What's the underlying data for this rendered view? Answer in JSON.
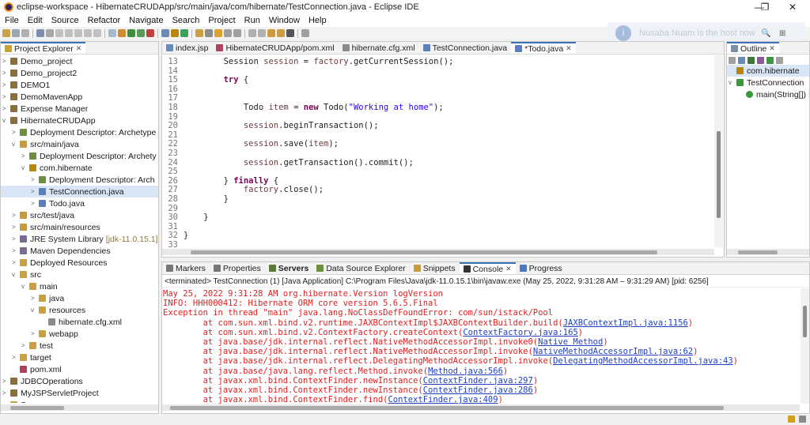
{
  "window": {
    "title": "eclipse-workspace - HibernateCRUDApp/src/main/java/com/hibernate/TestConnection.java - Eclipse IDE",
    "minimize": "—",
    "maximize": "❐",
    "close": "✕"
  },
  "menu": [
    "File",
    "Edit",
    "Source",
    "Refactor",
    "Navigate",
    "Search",
    "Project",
    "Run",
    "Window",
    "Help"
  ],
  "notification": {
    "avatar": "i",
    "text": "Nusaba Nuam is the host now"
  },
  "toolbar_right": {
    "search": "🔍",
    "perspective": "⊞"
  },
  "project_explorer": {
    "tab": "Project Explorer",
    "close": "✕",
    "items": [
      {
        "label": "Demo_project",
        "extra": "",
        "twisty": ">",
        "icon": "project",
        "color": "#8a6e3b",
        "depth": 0
      },
      {
        "label": "Demo_project2",
        "extra": "",
        "twisty": ">",
        "icon": "project",
        "color": "#8a6e3b",
        "depth": 0
      },
      {
        "label": "DEMO1",
        "extra": "",
        "twisty": ">",
        "icon": "project",
        "color": "#8a6e3b",
        "depth": 0
      },
      {
        "label": "DemoMavenApp",
        "extra": "",
        "twisty": ">",
        "icon": "project",
        "color": "#8a6e3b",
        "depth": 0
      },
      {
        "label": "Expense Manager",
        "extra": "",
        "twisty": ">",
        "icon": "project",
        "color": "#8a6e3b",
        "depth": 0
      },
      {
        "label": "HibernateCRUDApp",
        "extra": "",
        "twisty": "v",
        "icon": "project",
        "color": "#8a6e3b",
        "depth": 0
      },
      {
        "label": "Deployment Descriptor: Archetype",
        "extra": "",
        "twisty": ">",
        "icon": "descriptor",
        "color": "#6b8f3a",
        "depth": 1
      },
      {
        "label": "src/main/java",
        "extra": "",
        "twisty": "v",
        "icon": "src-folder",
        "color": "#c89b38",
        "depth": 1
      },
      {
        "label": "Deployment Descriptor: Archety",
        "extra": "",
        "twisty": ">",
        "icon": "descriptor",
        "color": "#6b8f3a",
        "depth": 2
      },
      {
        "label": "com.hibernate",
        "extra": "",
        "twisty": "v",
        "icon": "package",
        "color": "#b8860b",
        "depth": 2
      },
      {
        "label": "Deployment Descriptor: Arch",
        "extra": "",
        "twisty": ">",
        "icon": "descriptor",
        "color": "#6b8f3a",
        "depth": 3
      },
      {
        "label": "TestConnection.java",
        "extra": "",
        "twisty": ">",
        "icon": "java-file",
        "color": "#5a7fbf",
        "depth": 3,
        "selected": true
      },
      {
        "label": "Todo.java",
        "extra": "",
        "twisty": ">",
        "icon": "java-file",
        "color": "#5a7fbf",
        "depth": 3
      },
      {
        "label": "src/test/java",
        "extra": "",
        "twisty": ">",
        "icon": "src-folder",
        "color": "#c89b38",
        "depth": 1
      },
      {
        "label": "src/main/resources",
        "extra": "",
        "twisty": ">",
        "icon": "src-folder",
        "color": "#c89b38",
        "depth": 1
      },
      {
        "label": "JRE System Library",
        "extra": "[jdk-11.0.15.1]",
        "twisty": ">",
        "icon": "library",
        "color": "#7a6a9a",
        "depth": 1
      },
      {
        "label": "Maven Dependencies",
        "extra": "",
        "twisty": ">",
        "icon": "library",
        "color": "#7a6a9a",
        "depth": 1
      },
      {
        "label": "Deployed Resources",
        "extra": "",
        "twisty": ">",
        "icon": "folder",
        "color": "#c8a040",
        "depth": 1
      },
      {
        "label": "src",
        "extra": "",
        "twisty": "v",
        "icon": "folder",
        "color": "#c8a040",
        "depth": 1
      },
      {
        "label": "main",
        "extra": "",
        "twisty": "v",
        "icon": "folder",
        "color": "#c8a040",
        "depth": 2
      },
      {
        "label": "java",
        "extra": "",
        "twisty": ">",
        "icon": "folder",
        "color": "#c8a040",
        "depth": 3
      },
      {
        "label": "resources",
        "extra": "",
        "twisty": "v",
        "icon": "folder",
        "color": "#c8a040",
        "depth": 3
      },
      {
        "label": "hibernate.cfg.xml",
        "extra": "",
        "twisty": "",
        "icon": "xml-file",
        "color": "#8a8a8a",
        "depth": 4
      },
      {
        "label": "webapp",
        "extra": "",
        "twisty": ">",
        "icon": "folder",
        "color": "#c8a040",
        "depth": 3
      },
      {
        "label": "test",
        "extra": "",
        "twisty": ">",
        "icon": "folder",
        "color": "#c8a040",
        "depth": 2
      },
      {
        "label": "target",
        "extra": "",
        "twisty": ">",
        "icon": "folder",
        "color": "#c8a040",
        "depth": 1
      },
      {
        "label": "pom.xml",
        "extra": "",
        "twisty": "",
        "icon": "xml-file",
        "color": "#b04060",
        "depth": 1
      },
      {
        "label": "JDBCOperations",
        "extra": "",
        "twisty": ">",
        "icon": "project",
        "color": "#8a6e3b",
        "depth": 0
      },
      {
        "label": "MyJSPServletProject",
        "extra": "",
        "twisty": ">",
        "icon": "project",
        "color": "#8a6e3b",
        "depth": 0
      },
      {
        "label": "Servers",
        "extra": "",
        "twisty": ">",
        "icon": "folder",
        "color": "#c8a040",
        "depth": 0
      }
    ]
  },
  "editor": {
    "tabs": [
      {
        "label": "index.jsp",
        "icon": "jsp-file",
        "color": "#6a8bb5",
        "active": false
      },
      {
        "label": "HibernateCRUDApp/pom.xml",
        "icon": "xml-file",
        "color": "#b04060",
        "active": false
      },
      {
        "label": "hibernate.cfg.xml",
        "icon": "xml-file",
        "color": "#8a8a8a",
        "active": false
      },
      {
        "label": "TestConnection.java",
        "icon": "java-file",
        "color": "#5a7fbf",
        "active": false
      },
      {
        "label": "*Todo.java",
        "icon": "java-file",
        "color": "#5a7fbf",
        "active": true
      }
    ],
    "tab_close": "✕",
    "lines": [
      {
        "n": "13",
        "t": [
          {
            "c": "",
            "s": "        Session "
          },
          {
            "c": "vr",
            "s": "session"
          },
          {
            "c": "",
            "s": " = "
          },
          {
            "c": "vr",
            "s": "factory"
          },
          {
            "c": "",
            "s": ".getCurrentSession();"
          }
        ]
      },
      {
        "n": "14",
        "t": []
      },
      {
        "n": "15",
        "t": [
          {
            "c": "",
            "s": "        "
          },
          {
            "c": "kw",
            "s": "try"
          },
          {
            "c": "",
            "s": " {"
          }
        ]
      },
      {
        "n": "16",
        "t": []
      },
      {
        "n": "17",
        "t": []
      },
      {
        "n": "18",
        "t": [
          {
            "c": "",
            "s": "            Todo "
          },
          {
            "c": "vr",
            "s": "item"
          },
          {
            "c": "",
            "s": " = "
          },
          {
            "c": "kw",
            "s": "new"
          },
          {
            "c": "",
            "s": " Todo("
          },
          {
            "c": "st",
            "s": "\"Working at home\""
          },
          {
            "c": "",
            "s": ");"
          }
        ]
      },
      {
        "n": "19",
        "t": []
      },
      {
        "n": "20",
        "t": [
          {
            "c": "",
            "s": "            "
          },
          {
            "c": "vr",
            "s": "session"
          },
          {
            "c": "",
            "s": ".beginTransaction();"
          }
        ]
      },
      {
        "n": "21",
        "t": []
      },
      {
        "n": "22",
        "t": [
          {
            "c": "",
            "s": "            "
          },
          {
            "c": "vr",
            "s": "session"
          },
          {
            "c": "",
            "s": ".save("
          },
          {
            "c": "vr",
            "s": "item"
          },
          {
            "c": "",
            "s": ");"
          }
        ]
      },
      {
        "n": "23",
        "t": []
      },
      {
        "n": "24",
        "t": [
          {
            "c": "",
            "s": "            "
          },
          {
            "c": "vr",
            "s": "session"
          },
          {
            "c": "",
            "s": ".getTransaction().commit();"
          }
        ]
      },
      {
        "n": "25",
        "t": []
      },
      {
        "n": "26",
        "t": [
          {
            "c": "",
            "s": "        } "
          },
          {
            "c": "kw",
            "s": "finally"
          },
          {
            "c": "",
            "s": " {"
          }
        ]
      },
      {
        "n": "27",
        "t": [
          {
            "c": "",
            "s": "            "
          },
          {
            "c": "vr",
            "s": "factory"
          },
          {
            "c": "",
            "s": ".close();"
          }
        ]
      },
      {
        "n": "28",
        "t": [
          {
            "c": "",
            "s": "        }"
          }
        ]
      },
      {
        "n": "29",
        "t": []
      },
      {
        "n": "30",
        "t": [
          {
            "c": "",
            "s": "    }"
          }
        ]
      },
      {
        "n": "31",
        "t": []
      },
      {
        "n": "32",
        "t": [
          {
            "c": "",
            "s": "}"
          }
        ]
      },
      {
        "n": "33",
        "t": []
      }
    ]
  },
  "outline": {
    "tab": "Outline",
    "close": "✕",
    "items": [
      {
        "label": "com.hibernate",
        "twisty": "",
        "color": "#b8860b",
        "depth": 0,
        "selected": true
      },
      {
        "label": "TestConnection",
        "twisty": "v",
        "color": "#3a9a3a",
        "depth": 0,
        "selected": false
      },
      {
        "label": "main(String[]) :",
        "twisty": "",
        "color": "#3a9a3a",
        "depth": 1,
        "selected": false
      }
    ]
  },
  "console": {
    "tabs": [
      {
        "label": "Markers",
        "color": "#777",
        "active": false
      },
      {
        "label": "Properties",
        "color": "#777",
        "active": false
      },
      {
        "label": "Servers",
        "color": "#5b7a3a",
        "active": false,
        "bold": true
      },
      {
        "label": "Data Source Explorer",
        "color": "#6b8f3a",
        "active": false
      },
      {
        "label": "Snippets",
        "color": "#c89b38",
        "active": false
      },
      {
        "label": "Console",
        "color": "#333",
        "active": true
      },
      {
        "label": "Progress",
        "color": "#4a7ac0",
        "active": false
      }
    ],
    "tab_close": "✕",
    "header": "<terminated> TestConnection (1) [Java Application] C:\\Program Files\\Java\\jdk-11.0.15.1\\bin\\javaw.exe  (May 25, 2022, 9:31:28 AM – 9:31:29 AM) [pid: 6256]",
    "lines": [
      {
        "t": [
          {
            "c": "",
            "s": "May 25, 2022 9:31:28 AM org.hibernate.Version logVersion"
          }
        ]
      },
      {
        "t": [
          {
            "c": "",
            "s": "INFO: HHH000412: Hibernate ORM core version 5.6.5.Final"
          }
        ]
      },
      {
        "t": [
          {
            "c": "",
            "s": "Exception in thread \"main\" java.lang.NoClassDefFoundError: com/sun/istack/Pool"
          }
        ]
      },
      {
        "t": [
          {
            "c": "",
            "s": "\tat com.sun.xml.bind.v2.runtime.JAXBContextImpl$JAXBContextBuilder.build("
          },
          {
            "c": "lk",
            "s": "JAXBContextImpl.java:1156"
          },
          {
            "c": "",
            "s": ")"
          }
        ]
      },
      {
        "t": [
          {
            "c": "",
            "s": "\tat com.sun.xml.bind.v2.ContextFactory.createContext("
          },
          {
            "c": "lk",
            "s": "ContextFactory.java:165"
          },
          {
            "c": "",
            "s": ")"
          }
        ]
      },
      {
        "t": [
          {
            "c": "",
            "s": "\tat java.base/jdk.internal.reflect.NativeMethodAccessorImpl.invoke0("
          },
          {
            "c": "lk",
            "s": "Native Method"
          },
          {
            "c": "",
            "s": ")"
          }
        ]
      },
      {
        "t": [
          {
            "c": "",
            "s": "\tat java.base/jdk.internal.reflect.NativeMethodAccessorImpl.invoke("
          },
          {
            "c": "lk",
            "s": "NativeMethodAccessorImpl.java:62"
          },
          {
            "c": "",
            "s": ")"
          }
        ]
      },
      {
        "t": [
          {
            "c": "",
            "s": "\tat java.base/jdk.internal.reflect.DelegatingMethodAccessorImpl.invoke("
          },
          {
            "c": "lk",
            "s": "DelegatingMethodAccessorImpl.java:43"
          },
          {
            "c": "",
            "s": ")"
          }
        ]
      },
      {
        "t": [
          {
            "c": "",
            "s": "\tat java.base/java.lang.reflect.Method.invoke("
          },
          {
            "c": "lk",
            "s": "Method.java:566"
          },
          {
            "c": "",
            "s": ")"
          }
        ]
      },
      {
        "t": [
          {
            "c": "",
            "s": "\tat javax.xml.bind.ContextFinder.newInstance("
          },
          {
            "c": "lk",
            "s": "ContextFinder.java:297"
          },
          {
            "c": "",
            "s": ")"
          }
        ]
      },
      {
        "t": [
          {
            "c": "",
            "s": "\tat javax.xml.bind.ContextFinder.newInstance("
          },
          {
            "c": "lk",
            "s": "ContextFinder.java:286"
          },
          {
            "c": "",
            "s": ")"
          }
        ]
      },
      {
        "t": [
          {
            "c": "",
            "s": "\tat javax.xml.bind.ContextFinder.find("
          },
          {
            "c": "lk",
            "s": "ContextFinder.java:409"
          },
          {
            "c": "",
            "s": ")"
          }
        ]
      }
    ]
  },
  "colors": {
    "accent": "#3b73b9",
    "error": "#e02020",
    "link": "#2040c0",
    "keyword": "#7f0055",
    "string": "#2a00ff"
  }
}
